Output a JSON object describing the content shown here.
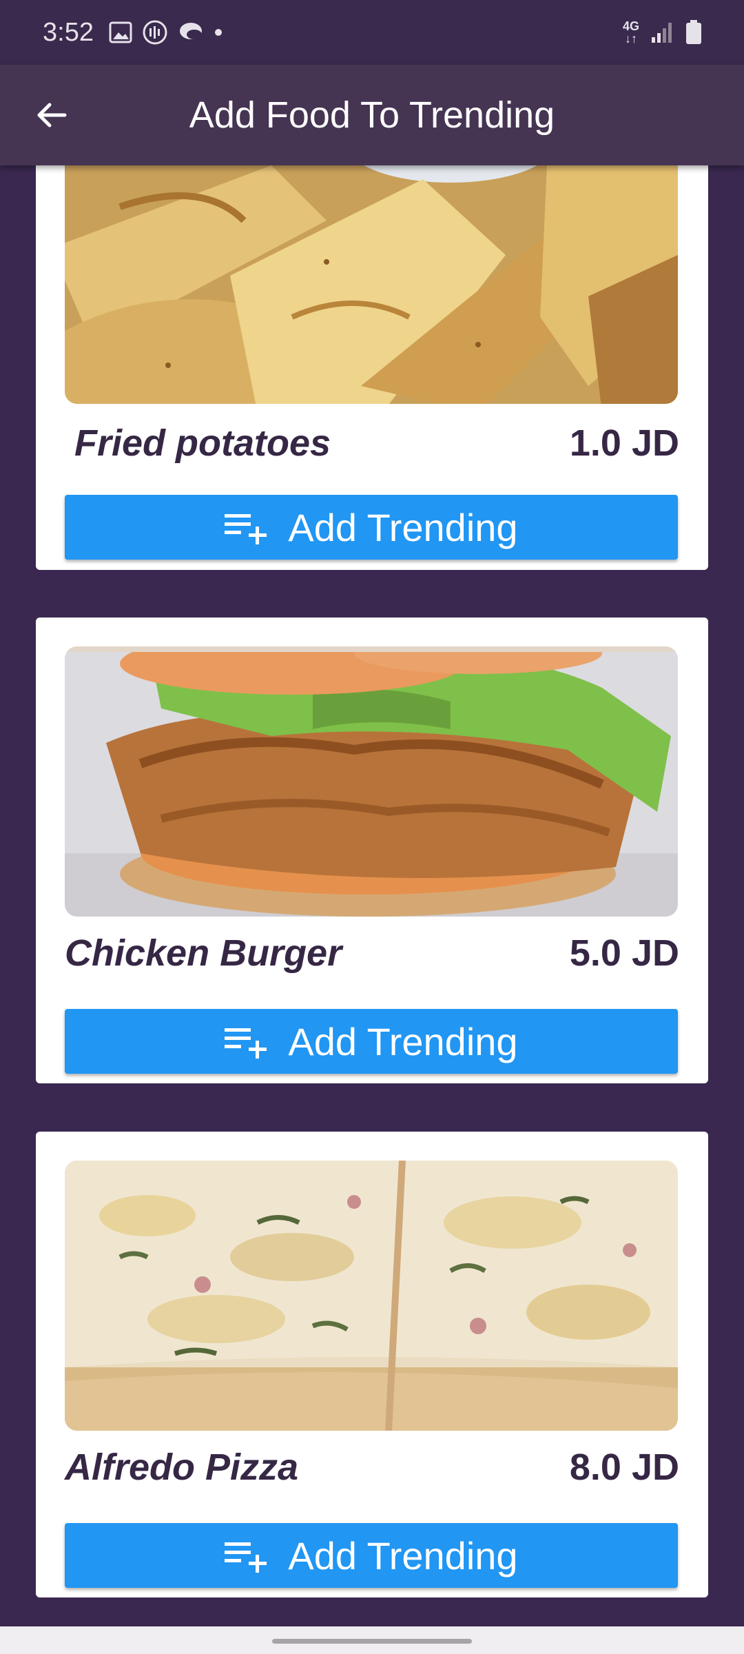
{
  "status_bar": {
    "time": "3:52",
    "network": "4G"
  },
  "app_bar": {
    "title": "Add Food To Trending"
  },
  "colors": {
    "background": "#3a2850",
    "app_bar": "#463453",
    "button": "#2196f3",
    "text_dark": "#362745"
  },
  "foods": [
    {
      "name": "Fried potatoes",
      "price": "1.0 JD",
      "button_label": "Add Trending",
      "image_icon": "fried-potatoes-image"
    },
    {
      "name": "Chicken Burger",
      "price": "5.0 JD",
      "button_label": "Add Trending",
      "image_icon": "chicken-burger-image"
    },
    {
      "name": "Alfredo Pizza",
      "price": "8.0 JD",
      "button_label": "Add Trending",
      "image_icon": "alfredo-pizza-image"
    }
  ]
}
